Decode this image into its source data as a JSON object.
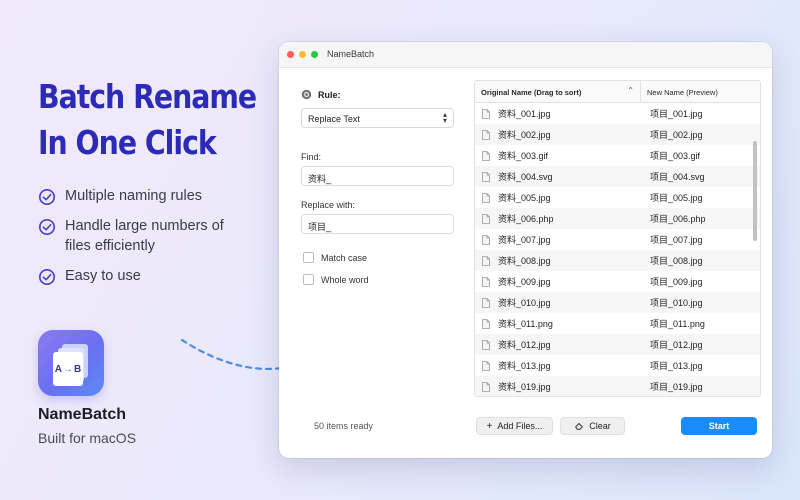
{
  "promo": {
    "headline_line1": "Batch Rename",
    "headline_line2": "In One Click",
    "features": [
      "Multiple naming rules",
      "Handle large numbers of files efficiently",
      "Easy to use"
    ],
    "app_name": "NameBatch",
    "app_subtitle": "Built for macOS",
    "icon_text_from": "A",
    "icon_text_to": "B"
  },
  "window": {
    "title": "NameBatch",
    "rule_label": "Rule:",
    "rule_selected": "Replace Text",
    "find_label": "Find:",
    "find_value": "资料_",
    "replace_label": "Replace with:",
    "replace_value": "项目_",
    "match_case_label": "Match case",
    "whole_word_label": "Whole word",
    "table": {
      "col_original": "Original Name (Drag to sort)",
      "col_new": "New Name (Preview)",
      "rows": [
        {
          "original": "资料_001.jpg",
          "new": "项目_001.jpg"
        },
        {
          "original": "资料_002.jpg",
          "new": "项目_002.jpg"
        },
        {
          "original": "资料_003.gif",
          "new": "项目_003.gif"
        },
        {
          "original": "资料_004.svg",
          "new": "项目_004.svg"
        },
        {
          "original": "资料_005.jpg",
          "new": "项目_005.jpg"
        },
        {
          "original": "资料_006.php",
          "new": "项目_006.php"
        },
        {
          "original": "资料_007.jpg",
          "new": "项目_007.jpg"
        },
        {
          "original": "资料_008.jpg",
          "new": "项目_008.jpg"
        },
        {
          "original": "资料_009.jpg",
          "new": "项目_009.jpg"
        },
        {
          "original": "资料_010.jpg",
          "new": "项目_010.jpg"
        },
        {
          "original": "资料_011.png",
          "new": "项目_011.png"
        },
        {
          "original": "资料_012.jpg",
          "new": "项目_012.jpg"
        },
        {
          "original": "资料_013.jpg",
          "new": "项目_013.jpg"
        },
        {
          "original": "资料_019.jpg",
          "new": "项目_019.jpg"
        }
      ]
    },
    "status_text": "50 items ready",
    "add_files_label": "Add Files...",
    "clear_label": "Clear",
    "start_label": "Start"
  },
  "colors": {
    "headline": "#2b2bb8",
    "accent_blue": "#1a8cff",
    "check_purple": "#4a3fc9"
  }
}
